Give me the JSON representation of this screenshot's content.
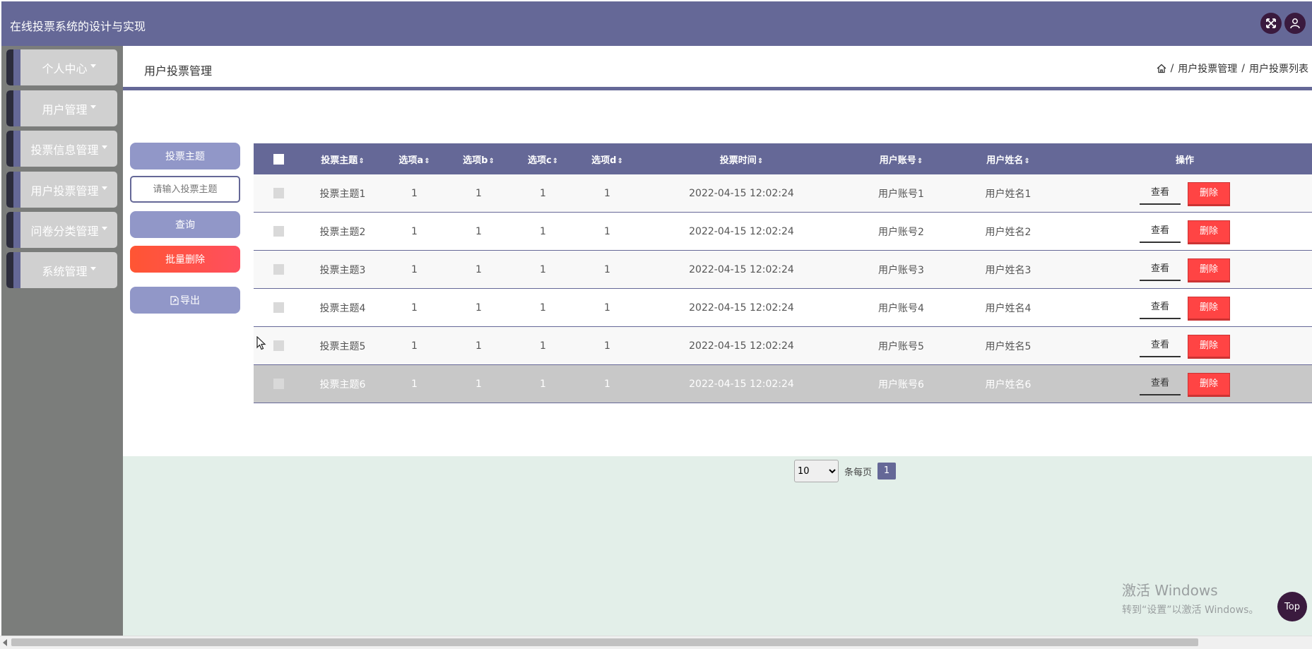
{
  "app": {
    "title": "在线投票系统的设计与实现"
  },
  "topbar": {
    "fullscreen_icon": "fullscreen-icon",
    "user_icon": "user-icon"
  },
  "sidebar": {
    "items": [
      {
        "label": "个人中心"
      },
      {
        "label": "用户管理"
      },
      {
        "label": "投票信息管理"
      },
      {
        "label": "用户投票管理"
      },
      {
        "label": "问卷分类管理"
      },
      {
        "label": "系统管理"
      }
    ]
  },
  "page": {
    "title": "用户投票管理",
    "breadcrumb": [
      "用户投票管理",
      "用户投票列表"
    ],
    "breadcrumb_sep": "/",
    "home_icon": "home-icon"
  },
  "filter": {
    "field_label": "投票主题",
    "search_placeholder": "请输入投票主题",
    "query_label": "查询",
    "batch_delete_label": "批量删除",
    "export_label": "导出"
  },
  "table": {
    "sort_glyph": "⇕",
    "columns": [
      "投票主题",
      "选项a",
      "选项b",
      "选项c",
      "选项d",
      "投票时间",
      "用户账号",
      "用户姓名",
      "操作"
    ],
    "view_label": "查看",
    "delete_label": "删除",
    "rows": [
      {
        "subject": "投票主题1",
        "a": "1",
        "b": "1",
        "c": "1",
        "d": "1",
        "time": "2022-04-15 12:02:24",
        "account": "用户账号1",
        "name": "用户姓名1"
      },
      {
        "subject": "投票主题2",
        "a": "1",
        "b": "1",
        "c": "1",
        "d": "1",
        "time": "2022-04-15 12:02:24",
        "account": "用户账号2",
        "name": "用户姓名2"
      },
      {
        "subject": "投票主题3",
        "a": "1",
        "b": "1",
        "c": "1",
        "d": "1",
        "time": "2022-04-15 12:02:24",
        "account": "用户账号3",
        "name": "用户姓名3"
      },
      {
        "subject": "投票主题4",
        "a": "1",
        "b": "1",
        "c": "1",
        "d": "1",
        "time": "2022-04-15 12:02:24",
        "account": "用户账号4",
        "name": "用户姓名4"
      },
      {
        "subject": "投票主题5",
        "a": "1",
        "b": "1",
        "c": "1",
        "d": "1",
        "time": "2022-04-15 12:02:24",
        "account": "用户账号5",
        "name": "用户姓名5"
      },
      {
        "subject": "投票主题6",
        "a": "1",
        "b": "1",
        "c": "1",
        "d": "1",
        "time": "2022-04-15 12:02:24",
        "account": "用户账号6",
        "name": "用户姓名6"
      }
    ]
  },
  "pagination": {
    "page_size": "10",
    "per_page_label": "条每页",
    "current_page": "1"
  },
  "watermark": {
    "line1": "激活 Windows",
    "line2": "转到“设置”以激活 Windows。"
  },
  "back_to_top": {
    "label": "Top"
  },
  "colors": {
    "primary": "#656897",
    "sidebar_bg": "#7b7d7b",
    "main_bg": "#e3efe9",
    "danger": "#ff4444",
    "batch_delete_gradient": [
      "#ff5533",
      "#ff4f5e"
    ],
    "soft_button": "#9197c8"
  }
}
